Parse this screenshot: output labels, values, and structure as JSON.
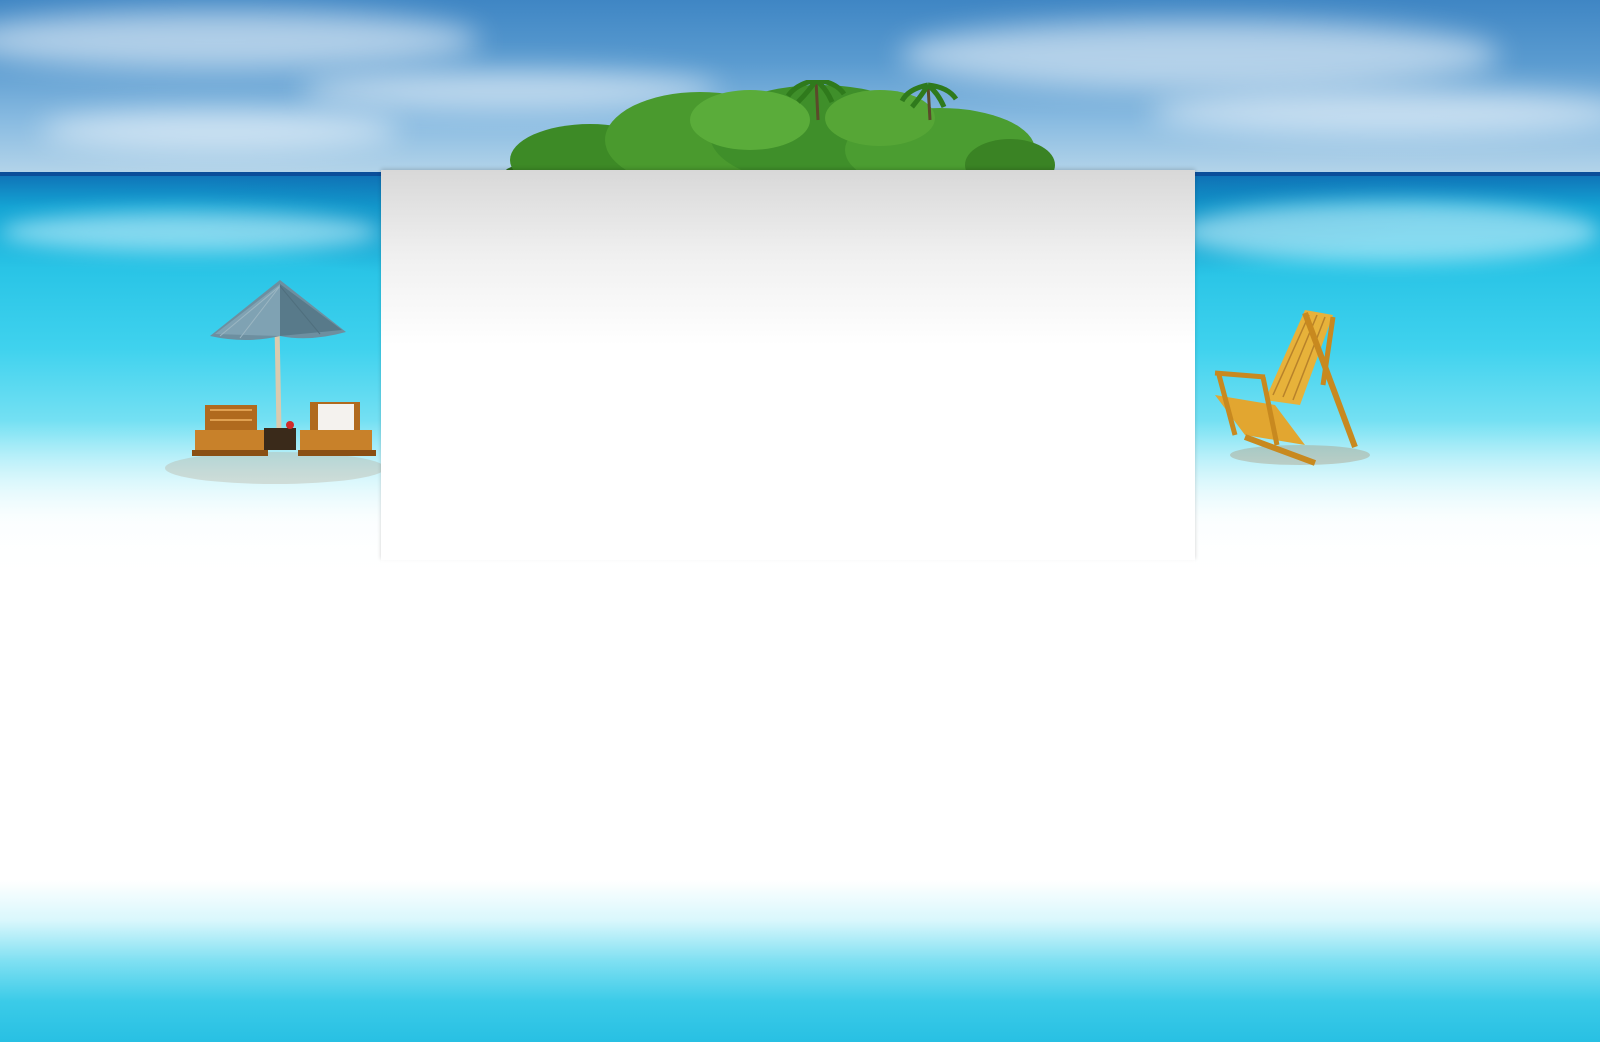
{
  "scene": {
    "icons": {
      "island": "tropical-island-icon",
      "umbrella": "thatched-umbrella-icon",
      "lounge_chairs": "lounge-chairs-icon",
      "deck_chair": "deck-chair-icon"
    },
    "colors": {
      "sky": "#5a9bd0",
      "deep_sea": "#0f6fb5",
      "lagoon": "#3fd2ee",
      "sand": "#ffffff",
      "foliage": "#3f8f2a",
      "wood": "#c8891f"
    }
  },
  "content_panel": {
    "text": ""
  }
}
